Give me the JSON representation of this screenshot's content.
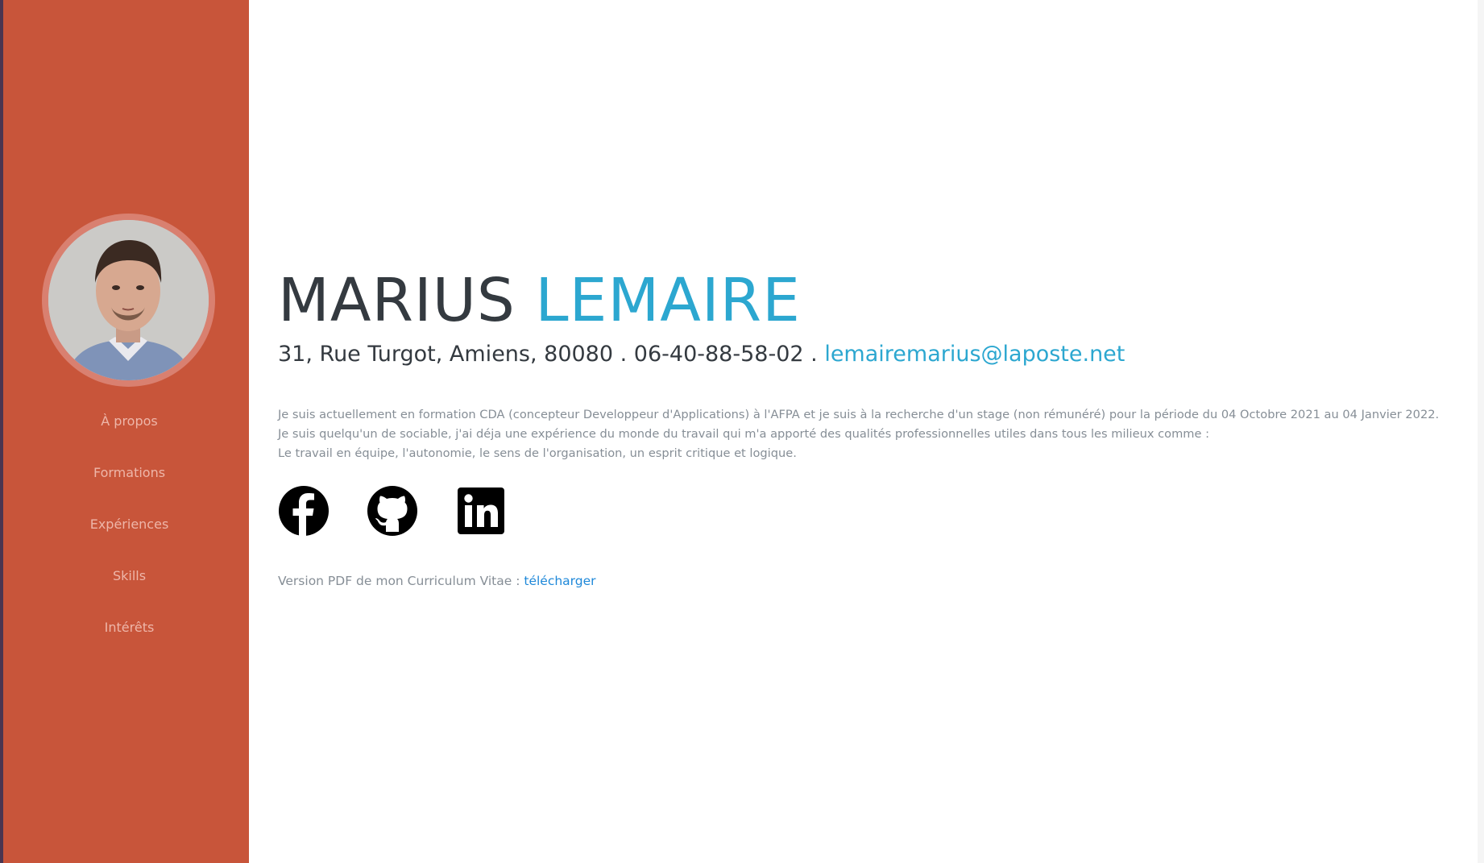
{
  "sidebar": {
    "nav_items": [
      {
        "label": "À propos"
      },
      {
        "label": "Formations"
      },
      {
        "label": "Expériences"
      },
      {
        "label": "Skills"
      },
      {
        "label": "Intérêts"
      }
    ]
  },
  "header": {
    "first_name": "MARIUS",
    "last_name": "LEMAIRE"
  },
  "contact": {
    "address": "31, Rue Turgot, Amiens, 80080",
    "separator": " . ",
    "phone": "06-40-88-58-02",
    "email": "lemairemarius@laposte.net"
  },
  "about": {
    "lines": [
      "Je suis actuellement en formation CDA (concepteur Developpeur d'Applications) à l'AFPA et je suis à la recherche d'un stage (non rémunéré) pour la période du 04 Octobre 2021 au 04 Janvier 2022.",
      "Je suis quelqu'un de sociable, j'ai déja une expérience du monde du travail qui m'a apporté des qualités professionnelles utiles dans tous les milieux comme :",
      "Le travail en équipe, l'autonomie, le sens de l'organisation, un esprit critique et logique."
    ]
  },
  "socials": {
    "icons": [
      "facebook-icon",
      "github-icon",
      "linkedin-icon"
    ]
  },
  "pdf": {
    "prefix": "Version PDF de mon Curriculum Vitae : ",
    "link_label": "télécharger"
  },
  "colors": {
    "sidebar": "#c8553a",
    "accent": "#2ca7d0",
    "nav_text": "#eeb6a9",
    "body_text": "#868e96",
    "heading": "#343a40"
  }
}
